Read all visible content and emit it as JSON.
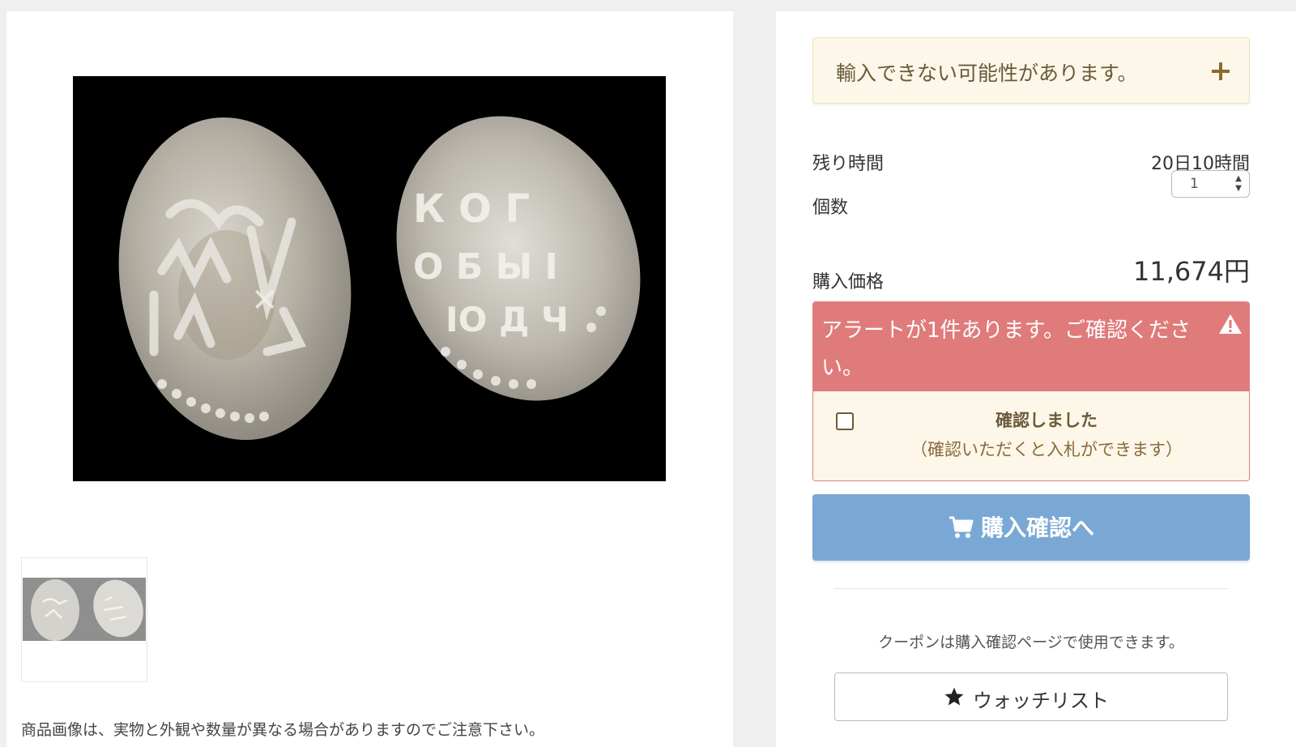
{
  "product": {
    "main_image_alt": "銀貨の写真",
    "thumbnail_alt": "銀貨のサムネイル",
    "image_note": "商品画像は、実物と外観や数量が異なる場合がありますのでご注意下さい。"
  },
  "purchase_panel": {
    "import_notice": "輸入できない可能性があります。",
    "time_left_label": "残り時間",
    "time_left_value": "20日10時間",
    "quantity_label": "個数",
    "quantity_value": "1",
    "price_label": "購入価格",
    "price_value": "11,674円",
    "alert": {
      "message": "アラートが1件あります。ご確認ください。",
      "confirm_strong": "確認しました",
      "confirm_note": "（確認いただくと入札ができます）"
    },
    "buy_button_label": "購入確認へ",
    "coupon_note": "クーポンは購入確認ページで使用できます。",
    "watchlist_label": "ウォッチリスト"
  },
  "colors": {
    "alert_red": "#e07b7b",
    "notice_bg": "#fcf7e8",
    "buy_blue": "#7aa8d4"
  },
  "icons": [
    "plus-icon",
    "warning-icon",
    "cart-icon",
    "star-icon"
  ]
}
